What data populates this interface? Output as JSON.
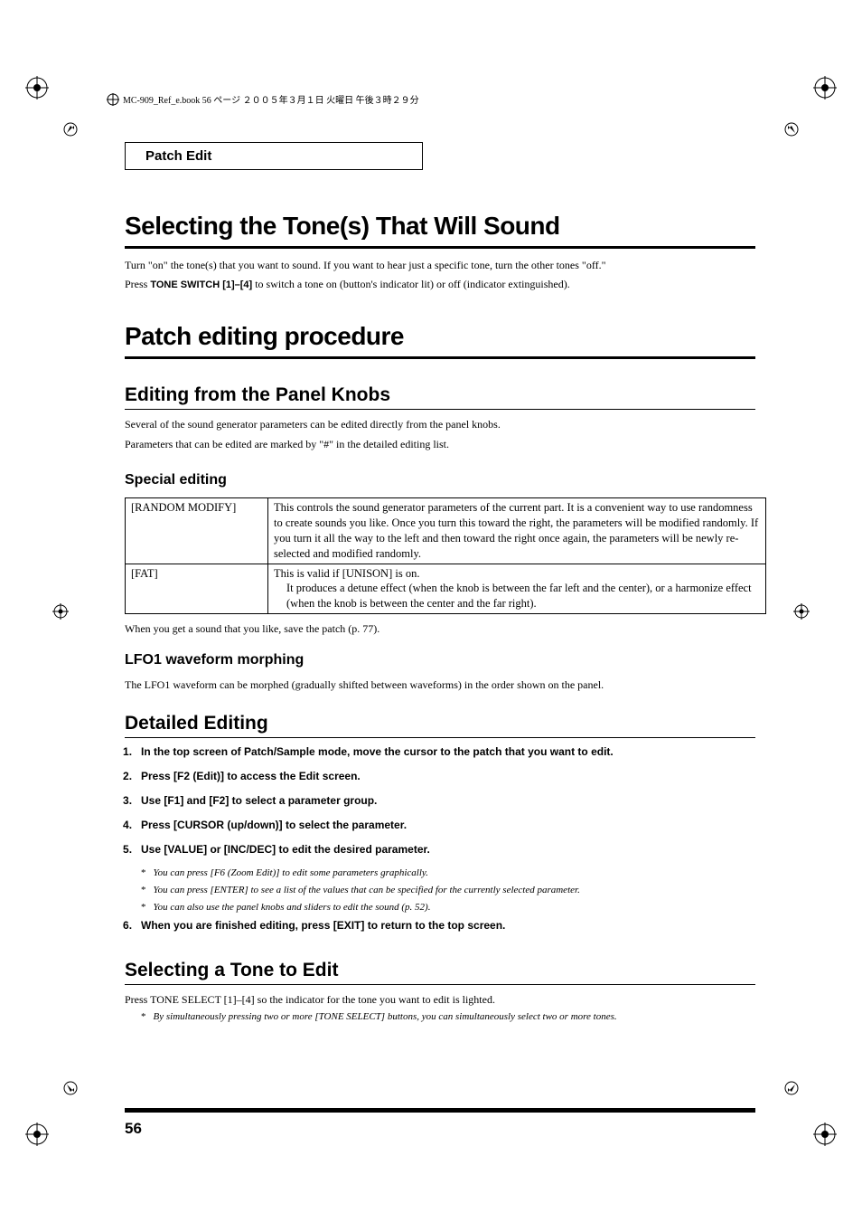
{
  "header": {
    "running_text": "MC-909_Ref_e.book 56 ページ ２００５年３月１日 火曜日 午後３時２９分"
  },
  "section_label": "Patch Edit",
  "h1_a": "Selecting the Tone(s) That Will Sound",
  "p_a1": "Turn \"on\" the tone(s) that you want to sound. If you want to hear just a specific tone, turn the other tones \"off.\"",
  "p_a2_pre": "Press ",
  "p_a2_bold": "TONE SWITCH [1]–[4]",
  "p_a2_post": " to switch a tone on (button's indicator lit) or off (indicator extinguished).",
  "h1_b": "Patch editing procedure",
  "h2_a": "Editing from the Panel Knobs",
  "p_b1": "Several of the sound generator parameters can be edited directly from the panel knobs.",
  "p_b2": "Parameters that can be edited are marked by \"#\" in the detailed editing list.",
  "h3_a": "Special editing",
  "table": {
    "r1c1": "[RANDOM MODIFY]",
    "r1c2": "This controls the sound generator parameters of the current part. It is a convenient way to use randomness to create sounds you like. Once you turn this toward the right, the parameters will be modified randomly. If you turn it all the way to the left and then toward the right once again, the parameters will be newly re-selected and modified randomly.",
    "r2c1": "[FAT]",
    "r2c2_l1": "This is valid if [UNISON] is on.",
    "r2c2_l2": "It produces a detune effect (when the knob is between the far left and the center), or a harmonize effect (when the knob is between the center and the far right)."
  },
  "p_c1": "When you get a sound that you like, save the patch (p. 77).",
  "h3_b": "LFO1 waveform morphing",
  "p_d1": "The LFO1 waveform can be morphed (gradually shifted between waveforms) in the order shown on the panel.",
  "h2_b": "Detailed Editing",
  "steps": {
    "s1": "In the top screen of Patch/Sample mode, move the cursor to the patch that you want to edit.",
    "s2": "Press [F2 (Edit)] to access the Edit screen.",
    "s3": "Use [F1] and [F2] to select a parameter group.",
    "s4": "Press [CURSOR (up/down)] to select the parameter.",
    "s5": "Use [VALUE] or [INC/DEC] to edit the desired parameter.",
    "s6": "When you are finished editing, press [EXIT] to return to the top screen."
  },
  "notes": {
    "n1": "You can press [F6 (Zoom Edit)] to edit some parameters graphically.",
    "n2": "You can press [ENTER] to see a list of the values that can be specified for the currently selected parameter.",
    "n3": "You can also use the panel knobs and sliders to edit the sound (p. 52)."
  },
  "h2_c": "Selecting a Tone to Edit",
  "p_e1": "Press TONE SELECT [1]–[4] so the indicator for the tone you want to edit is lighted.",
  "notes2": {
    "n1": "By simultaneously pressing two or more [TONE SELECT] buttons, you can simultaneously select two or more tones."
  },
  "page_number": "56"
}
